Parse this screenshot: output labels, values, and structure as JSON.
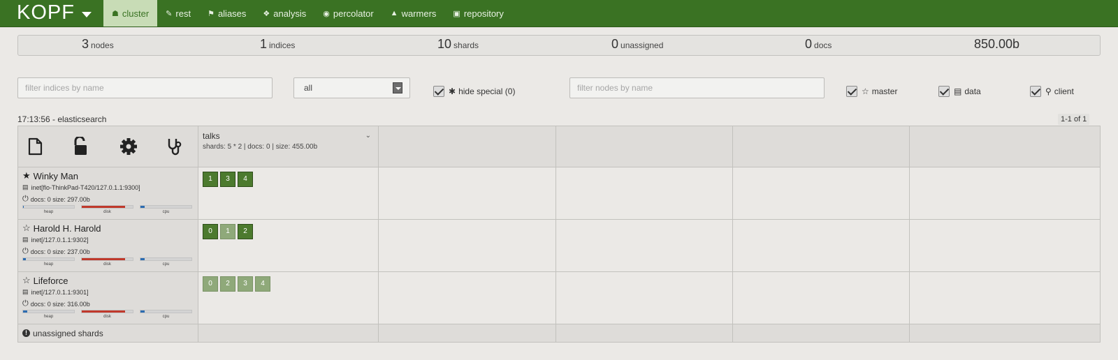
{
  "navbar": {
    "brand": "KOPF",
    "items": [
      {
        "label": "cluster",
        "icon": "sitemap-icon",
        "active": true
      },
      {
        "label": "rest",
        "icon": "edit-icon",
        "active": false
      },
      {
        "label": "aliases",
        "icon": "tags-icon",
        "active": false
      },
      {
        "label": "analysis",
        "icon": "puzzle-icon",
        "active": false
      },
      {
        "label": "percolator",
        "icon": "target-icon",
        "active": false
      },
      {
        "label": "warmers",
        "icon": "fire-icon",
        "active": false
      },
      {
        "label": "repository",
        "icon": "briefcase-icon",
        "active": false
      }
    ]
  },
  "stats": {
    "nodes": {
      "value": "3",
      "label": "nodes"
    },
    "indices": {
      "value": "1",
      "label": "indices"
    },
    "shards": {
      "value": "10",
      "label": "shards"
    },
    "unassigned": {
      "value": "0",
      "label": "unassigned"
    },
    "docs": {
      "value": "0",
      "label": "docs"
    },
    "size": {
      "value": "850.00b"
    }
  },
  "filters": {
    "indices_placeholder": "filter indices by name",
    "select_value": "all",
    "hide_special_label": "hide special (0)",
    "nodes_placeholder": "filter nodes by name",
    "master_label": "master",
    "data_label": "data",
    "client_label": "client"
  },
  "timestamp": "17:13:56 - elasticsearch",
  "pager": "1-1 of 1",
  "index": {
    "name": "talks",
    "meta": "shards: 5 * 2 | docs: 0 | size: 455.00b"
  },
  "bar_labels": {
    "heap": "heap",
    "disk": "disk",
    "cpu": "cpu"
  },
  "nodes": [
    {
      "name": "Winky Man",
      "master": true,
      "address": "inet[flo-ThinkPad-T420/127.0.1.1:9300]",
      "docs": "docs: 0  size: 297.00b",
      "heap": 0.02,
      "disk": 0.85,
      "cpu": 0.08,
      "shards": [
        {
          "id": "1",
          "primary": true
        },
        {
          "id": "3",
          "primary": true
        },
        {
          "id": "4",
          "primary": true
        }
      ]
    },
    {
      "name": "Harold H. Harold",
      "master": false,
      "address": "inet[/127.0.1.1:9302]",
      "docs": "docs: 0  size: 237.00b",
      "heap": 0.06,
      "disk": 0.85,
      "cpu": 0.08,
      "shards": [
        {
          "id": "0",
          "primary": true
        },
        {
          "id": "1",
          "primary": false
        },
        {
          "id": "2",
          "primary": true
        }
      ]
    },
    {
      "name": "Lifeforce",
      "master": false,
      "address": "inet[/127.0.1.1:9301]",
      "docs": "docs: 0  size: 316.00b",
      "heap": 0.08,
      "disk": 0.85,
      "cpu": 0.08,
      "shards": [
        {
          "id": "0",
          "primary": false
        },
        {
          "id": "2",
          "primary": false
        },
        {
          "id": "3",
          "primary": false
        },
        {
          "id": "4",
          "primary": false
        }
      ]
    }
  ],
  "unassigned_label": "unassigned shards",
  "colors": {
    "nav": "#3a7223",
    "primary_shard": "#4c7a2e",
    "replica_shard": "#8fa97a",
    "disk_bar": "#c0392b",
    "heap_bar": "#2c6cb0"
  }
}
